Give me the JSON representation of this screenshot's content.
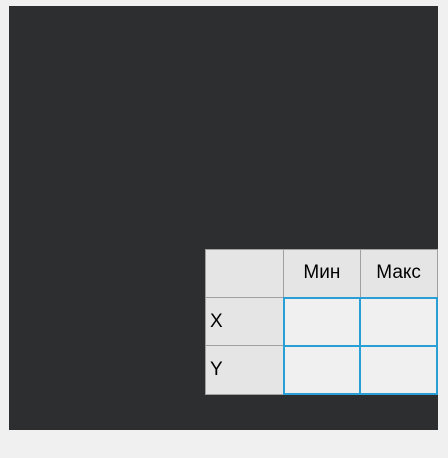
{
  "grid": {
    "columns": [
      "Мин",
      "Макс"
    ],
    "rows": [
      {
        "label": "X",
        "min": "",
        "max": ""
      },
      {
        "label": "Y",
        "min": "",
        "max": ""
      }
    ]
  },
  "colors": {
    "canvas": "#2d2e30",
    "cell_border": "#2a9fd6",
    "header_bg": "#e5e5e5"
  }
}
